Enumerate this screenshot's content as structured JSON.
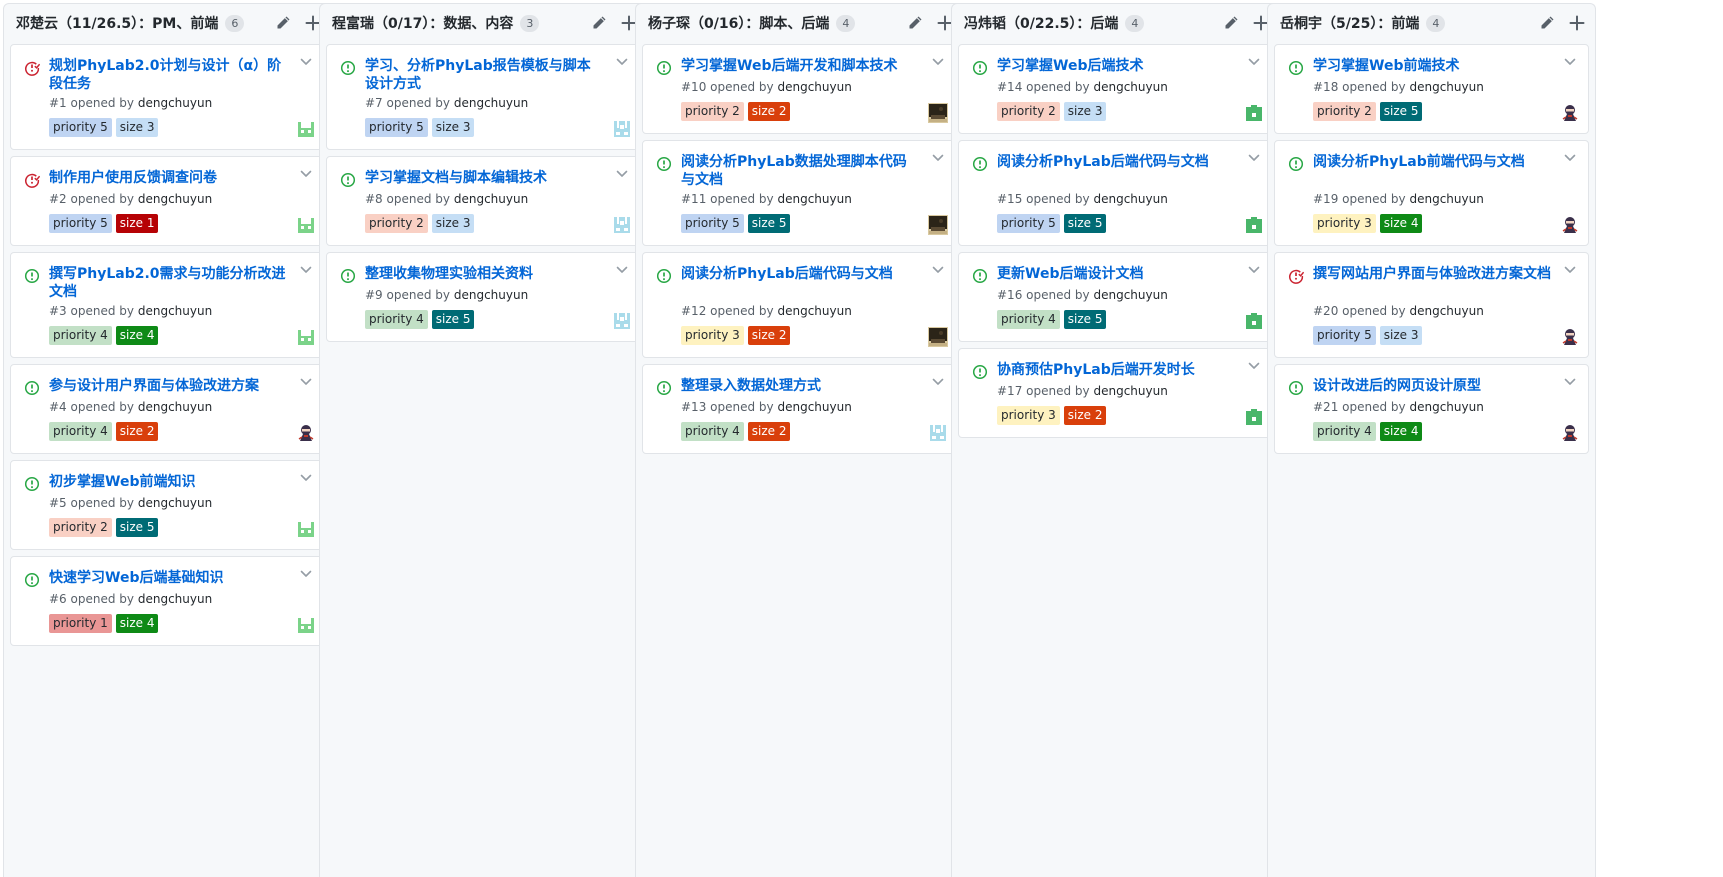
{
  "author_prefix": "opened by",
  "author": "dengchuyun",
  "colors": {
    "priority 1": [
      "#e99695",
      "#24292e"
    ],
    "priority 2": [
      "#f9d0c4",
      "#24292e"
    ],
    "priority 3": [
      "#fef2c0",
      "#24292e"
    ],
    "priority 4": [
      "#c2e0c6",
      "#24292e"
    ],
    "priority 5": [
      "#bfd4f2",
      "#24292e"
    ],
    "size 1": [
      "#b60205",
      "#ffffff"
    ],
    "size 2": [
      "#d93f0b",
      "#ffffff"
    ],
    "size 3": [
      "#c5def5",
      "#24292e"
    ],
    "size 4": [
      "#0e8a16",
      "#ffffff"
    ],
    "size 5": [
      "#006b75",
      "#ffffff"
    ]
  },
  "columns": [
    {
      "title": "邓楚云（11/26.5）：PM、前端",
      "count": "6",
      "cards": [
        {
          "state": "closed",
          "title": "规划PhyLab2.0计划与设计（α）阶段任务",
          "number": "#1",
          "labels": [
            "priority 5",
            "size 3"
          ],
          "avatar": "green-robot-avatar"
        },
        {
          "state": "closed",
          "title": "制作用户使用反馈调查问卷",
          "number": "#2",
          "labels": [
            "priority 5",
            "size 1"
          ],
          "avatar": "green-robot-avatar"
        },
        {
          "state": "open",
          "title": "撰写PhyLab2.0需求与功能分析改进文档",
          "number": "#3",
          "labels": [
            "priority 4",
            "size 4"
          ],
          "avatar": "green-robot-avatar"
        },
        {
          "state": "open",
          "title": "参与设计用户界面与体验改进方案",
          "number": "#4",
          "labels": [
            "priority 4",
            "size 2"
          ],
          "avatar": "ninja-avatar"
        },
        {
          "state": "open",
          "title": "初步掌握Web前端知识",
          "number": "#5",
          "labels": [
            "priority 2",
            "size 5"
          ],
          "avatar": "green-robot-avatar"
        },
        {
          "state": "open",
          "title": "快速学习Web后端基础知识",
          "number": "#6",
          "labels": [
            "priority 1",
            "size 4"
          ],
          "avatar": "green-robot-avatar"
        }
      ]
    },
    {
      "title": "程富瑞（0/17）：数据、内容",
      "count": "3",
      "cards": [
        {
          "state": "open",
          "title": "学习、分析PhyLab报告模板与脚本设计方式",
          "number": "#7",
          "labels": [
            "priority 5",
            "size 3"
          ],
          "avatar": "blue-pixel-avatar"
        },
        {
          "state": "open",
          "title": "学习掌握文档与脚本编辑技术",
          "number": "#8",
          "labels": [
            "priority 2",
            "size 3"
          ],
          "avatar": "blue-pixel-avatar"
        },
        {
          "state": "open",
          "title": "整理收集物理实验相关资料",
          "number": "#9",
          "labels": [
            "priority 4",
            "size 5"
          ],
          "avatar": "blue-pixel-avatar"
        }
      ]
    },
    {
      "title": "杨子琛（0/16）：脚本、后端",
      "count": "4",
      "cards": [
        {
          "state": "open",
          "title": "学习掌握Web后端开发和脚本技术",
          "number": "#10",
          "labels": [
            "priority 2",
            "size 2"
          ],
          "avatar": "photo-avatar"
        },
        {
          "state": "open",
          "title": "阅读分析PhyLab数据处理脚本代码与文档",
          "number": "#11",
          "labels": [
            "priority 5",
            "size 5"
          ],
          "avatar": "photo-avatar"
        },
        {
          "state": "open",
          "title": "阅读分析PhyLab后端代码与文档",
          "number": "#12",
          "labels": [
            "priority 3",
            "size 2"
          ],
          "avatar": "photo-avatar"
        },
        {
          "state": "open",
          "title": "整理录入数据处理方式",
          "number": "#13",
          "labels": [
            "priority 4",
            "size 2"
          ],
          "avatar": "blue-pixel-avatar"
        }
      ]
    },
    {
      "title": "冯炜韬（0/22.5）：后端",
      "count": "4",
      "cards": [
        {
          "state": "open",
          "title": "学习掌握Web后端技术",
          "number": "#14",
          "labels": [
            "priority 2",
            "size 3"
          ],
          "avatar": "green-block-avatar"
        },
        {
          "state": "open",
          "title": "阅读分析PhyLab后端代码与文档",
          "number": "#15",
          "labels": [
            "priority 5",
            "size 5"
          ],
          "avatar": "green-block-avatar"
        },
        {
          "state": "open",
          "title": "更新Web后端设计文档",
          "number": "#16",
          "labels": [
            "priority 4",
            "size 5"
          ],
          "avatar": "green-block-avatar"
        },
        {
          "state": "open",
          "title": "协商预估PhyLab后端开发时长",
          "number": "#17",
          "labels": [
            "priority 3",
            "size 2"
          ],
          "avatar": "green-block-avatar"
        }
      ]
    },
    {
      "title": "岳桐宇（5/25）：前端",
      "count": "4",
      "cards": [
        {
          "state": "open",
          "title": "学习掌握Web前端技术",
          "number": "#18",
          "labels": [
            "priority 2",
            "size 5"
          ],
          "avatar": "ninja-avatar"
        },
        {
          "state": "open",
          "title": "阅读分析PhyLab前端代码与文档",
          "number": "#19",
          "labels": [
            "priority 3",
            "size 4"
          ],
          "avatar": "ninja-avatar"
        },
        {
          "state": "closed",
          "title": "撰写网站用户界面与体验改进方案文档",
          "number": "#20",
          "labels": [
            "priority 5",
            "size 3"
          ],
          "avatar": "ninja-avatar"
        },
        {
          "state": "open",
          "title": "设计改进后的网页设计原型",
          "number": "#21",
          "labels": [
            "priority 4",
            "size 4"
          ],
          "avatar": "ninja-avatar"
        }
      ]
    }
  ]
}
